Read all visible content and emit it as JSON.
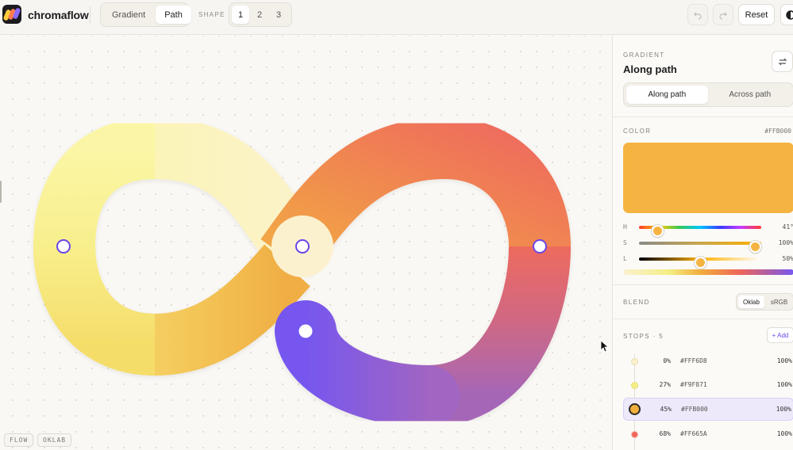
{
  "app": {
    "name": "chromaflow"
  },
  "toolbar": {
    "mode_tabs": [
      {
        "label": "Gradient",
        "active": false
      },
      {
        "label": "Path",
        "active": true
      }
    ],
    "shape_label": "SHAPE",
    "shape_options": [
      {
        "label": "1",
        "active": true
      },
      {
        "label": "2",
        "active": false
      },
      {
        "label": "3",
        "active": false
      }
    ],
    "undo_icon": "undo-arrow-icon",
    "redo_icon": "redo-arrow-icon",
    "reset_label": "Reset",
    "theme_icon": "contrast-icon"
  },
  "canvas": {
    "tags": [
      "FLOW",
      "OKLAB"
    ],
    "handles": [
      {
        "name": "stop-handle-0"
      },
      {
        "name": "stop-handle-27"
      },
      {
        "name": "stop-handle-45"
      },
      {
        "name": "stop-handle-68"
      },
      {
        "name": "stop-handle-100"
      }
    ]
  },
  "panel": {
    "gradient": {
      "heading": "GRADIENT",
      "title": "Along path",
      "swap_icon": "swap-arrows-icon",
      "tabs": [
        {
          "label": "Along path",
          "active": true
        },
        {
          "label": "Across path",
          "active": false
        }
      ]
    },
    "color": {
      "heading": "COLOR",
      "hex": "#FFB000",
      "preview_color": "#f5b342",
      "sliders": [
        {
          "label": "H",
          "value_text": "41°",
          "fraction": 0.15
        },
        {
          "label": "S",
          "value_text": "100%",
          "fraction": 0.95
        },
        {
          "label": "L",
          "value_text": "50%",
          "fraction": 0.5
        }
      ]
    },
    "blend": {
      "heading": "BLEND",
      "options": [
        {
          "label": "Oklab",
          "active": true
        },
        {
          "label": "sRGB",
          "active": false
        }
      ]
    },
    "stops": {
      "heading": "STOPS · 5",
      "add_label": "+ Add",
      "items": [
        {
          "pct": "0%",
          "hex": "#FFF6D8",
          "opacity": "100%",
          "color": "#fbf1cf",
          "selected": false
        },
        {
          "pct": "27%",
          "hex": "#F9F871",
          "opacity": "100%",
          "color": "#f4ee84",
          "selected": false
        },
        {
          "pct": "45%",
          "hex": "#FFB000",
          "opacity": "100%",
          "color": "#f2ae3c",
          "selected": true
        },
        {
          "pct": "68%",
          "hex": "#FF665A",
          "opacity": "100%",
          "color": "#ef6658",
          "selected": false
        }
      ]
    }
  }
}
